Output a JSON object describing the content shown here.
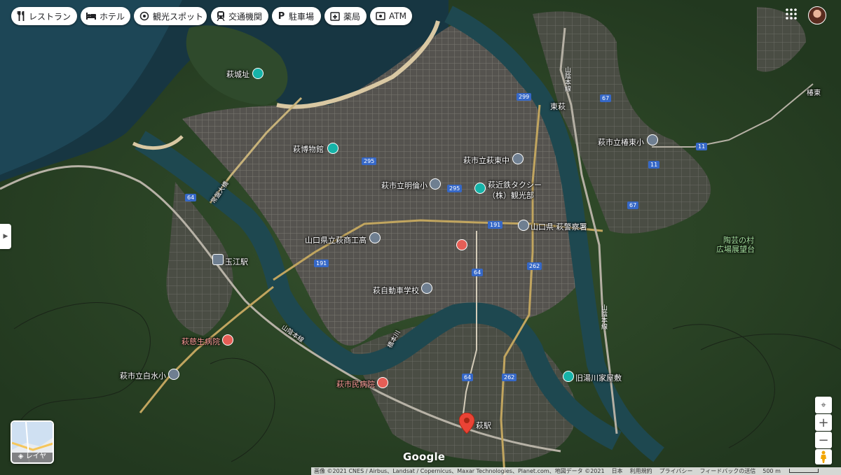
{
  "categories": [
    {
      "label": "レストラン",
      "icon": "restaurant-icon"
    },
    {
      "label": "ホテル",
      "icon": "hotel-icon"
    },
    {
      "label": "観光スポット",
      "icon": "attraction-icon"
    },
    {
      "label": "交通機関",
      "icon": "transit-icon"
    },
    {
      "label": "駐車場",
      "icon": "parking-icon"
    },
    {
      "label": "薬局",
      "icon": "pharmacy-icon"
    },
    {
      "label": "ATM",
      "icon": "atm-icon"
    }
  ],
  "places": {
    "hagi_castle_ruins": "萩城址",
    "hagi_museum": "萩博物館",
    "east_hagi_jhs": "萩市立萩東中",
    "meirin_es": "萩市立明倫小",
    "hagi_kintetsu_taxi_1": "萩近鉄タクシー",
    "hagi_kintetsu_taxi_2": "（株）観光部",
    "yamaguchi_commercial_hs": "山口県立萩商工高",
    "hagi_police": "山口県 萩警察署",
    "tamae_station": "玉江駅",
    "hagi_driving_school": "萩自動車学校",
    "jiseikai_hospital": "萩慈生病院",
    "shiroizu_es": "萩市立白水小",
    "city_hospital": "萩市民病院",
    "kyu_yukawa": "旧湯川家屋敷",
    "hagi_station": "萩駅",
    "higashi_hagi": "東萩",
    "tsubaki_higashi_es": "萩市立椿東小",
    "tsubaki_higashi": "椿東",
    "toge_village_1": "陶芸の村",
    "toge_village_2": "広場展望台",
    "hashimoto_river": "橋本川",
    "sanin_line": "山陰本線",
    "tokiwa_bridge": "常盤大橋"
  },
  "routes": [
    "299",
    "67",
    "295",
    "295",
    "11",
    "11",
    "64",
    "191",
    "191",
    "64",
    "262",
    "262",
    "64",
    "67"
  ],
  "layer_label": "レイヤ",
  "logo": "Google",
  "attribution": [
    "画像 ©2021 CNES / Airbus、Landsat / Copernicus、Maxar Technologies、Planet.com、地図データ ©2021",
    "日本",
    "利用規約",
    "プライバシー",
    "フィードバックの送信",
    "500 m"
  ]
}
